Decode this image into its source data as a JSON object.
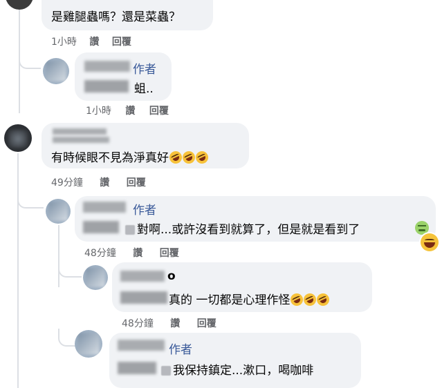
{
  "comments": [
    {
      "text": "是雞腿蟲嗎？還是菜蟲？",
      "time": "1小時",
      "like": "讚",
      "reply": "回覆"
    },
    {
      "badge": "作者",
      "text": "蛆..",
      "time": "1小時",
      "like": "讚",
      "reply": "回覆"
    },
    {
      "text": "有時候眼不見為淨真好",
      "time": "49分鐘",
      "like": "讚",
      "reply": "回覆",
      "emojis": [
        "rofl-emoji",
        "rofl-emoji",
        "rofl-emoji"
      ]
    },
    {
      "badge": "作者",
      "text": "對啊...或許沒看到就算了，但是就是看到了",
      "time": "48分鐘",
      "like": "讚",
      "reply": "回覆",
      "emojis": [
        "nauseated-emoji"
      ],
      "reaction": "grinning-reaction"
    },
    {
      "name_tail": "o",
      "text": "真的 一切都是心理作怪",
      "time": "48分鐘",
      "like": "讚",
      "reply": "回覆",
      "emojis": [
        "rofl-emoji",
        "rofl-emoji",
        "rofl-emoji"
      ]
    },
    {
      "badge": "作者",
      "text": "我保持鎮定...漱口，喝咖啡"
    }
  ],
  "colors": {
    "bubble": "#f0f2f5",
    "author_badge": "#385898",
    "meta": "#65676b",
    "thread_line": "#dcdfe4"
  }
}
